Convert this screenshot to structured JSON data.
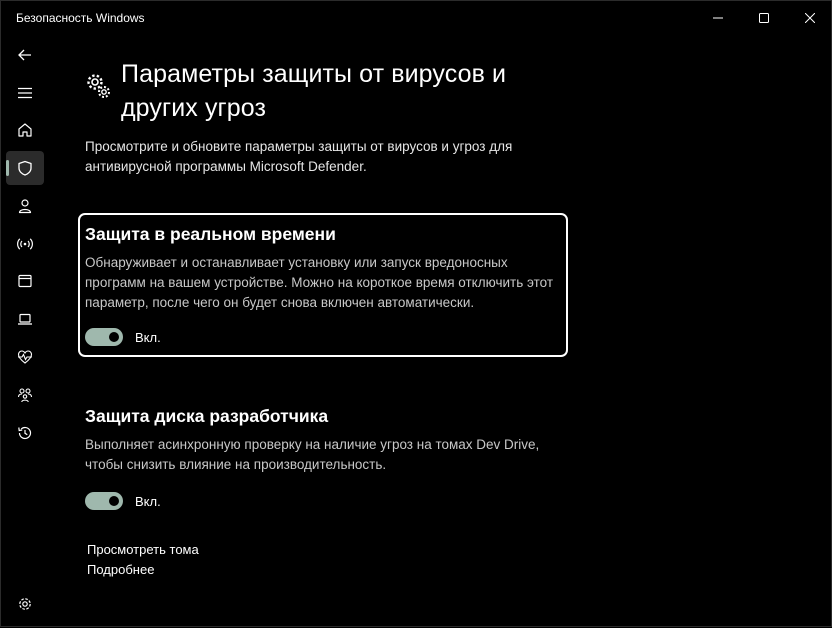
{
  "window": {
    "title": "Безопасность Windows"
  },
  "colors": {
    "accent": "#9fb8ad",
    "background": "#000000",
    "text": "#ffffff",
    "secondary_text": "#c8c8c8",
    "selected_nav": "#2b2b2b"
  },
  "sidebar": {
    "items": [
      {
        "icon": "back-arrow-icon"
      },
      {
        "icon": "hamburger-menu-icon"
      },
      {
        "icon": "home-icon"
      },
      {
        "icon": "shield-icon",
        "active": true
      },
      {
        "icon": "person-icon"
      },
      {
        "icon": "wireless-icon"
      },
      {
        "icon": "app-browser-icon"
      },
      {
        "icon": "laptop-icon"
      },
      {
        "icon": "heart-pulse-icon"
      },
      {
        "icon": "family-icon"
      },
      {
        "icon": "history-icon"
      },
      {
        "icon": "settings-gear-icon"
      }
    ]
  },
  "page": {
    "icon": "gears-icon",
    "title": "Параметры защиты от вирусов и других угроз",
    "description": "Просмотрите и обновите параметры защиты от вирусов и угроз для антивирусной программы Microsoft Defender."
  },
  "realtime": {
    "title": "Защита в реальном времени",
    "description": "Обнаруживает и останавливает установку или запуск вредоносных программ на вашем устройстве. Можно на короткое время отключить этот параметр, после чего он будет снова включен автоматически.",
    "toggle_label": "Вкл.",
    "enabled": true
  },
  "devdrive": {
    "title": "Защита диска разработчика",
    "description": "Выполняет асинхронную проверку на наличие угроз на томах Dev Drive, чтобы снизить влияние на производительность.",
    "toggle_label": "Вкл.",
    "enabled": true
  },
  "links": {
    "view_volumes": "Просмотреть тома",
    "more_info": "Подробнее"
  }
}
